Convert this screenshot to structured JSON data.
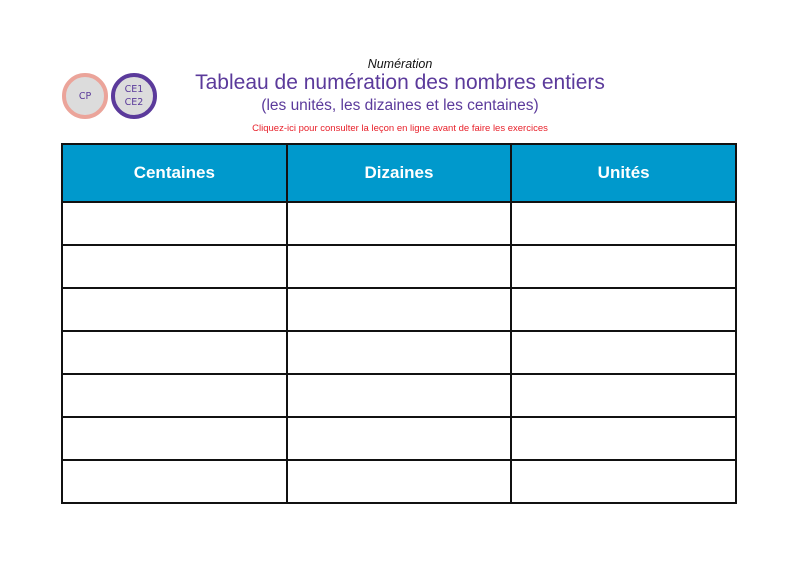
{
  "badges": {
    "level1": "CP",
    "level2_line1": "CE1",
    "level2_line2": "CE2"
  },
  "header": {
    "subject": "Numération",
    "title": "Tableau de numération des nombres entiers",
    "subtitle": "(les unités, les dizaines et les centaines)",
    "link": "Cliquez-ici pour consulter la leçon en ligne avant de faire les exercices"
  },
  "colors": {
    "header_bg": "#0099cc",
    "title": "#5b3a9b",
    "link": "#e8202a",
    "cp_ring": "#eba49a",
    "ce_ring": "#5b3a9b"
  },
  "table": {
    "columns": [
      "Centaines",
      "Dizaines",
      "Unités"
    ],
    "rows": [
      [
        "",
        "",
        ""
      ],
      [
        "",
        "",
        ""
      ],
      [
        "",
        "",
        ""
      ],
      [
        "",
        "",
        ""
      ],
      [
        "",
        "",
        ""
      ],
      [
        "",
        "",
        ""
      ],
      [
        "",
        "",
        ""
      ]
    ]
  }
}
